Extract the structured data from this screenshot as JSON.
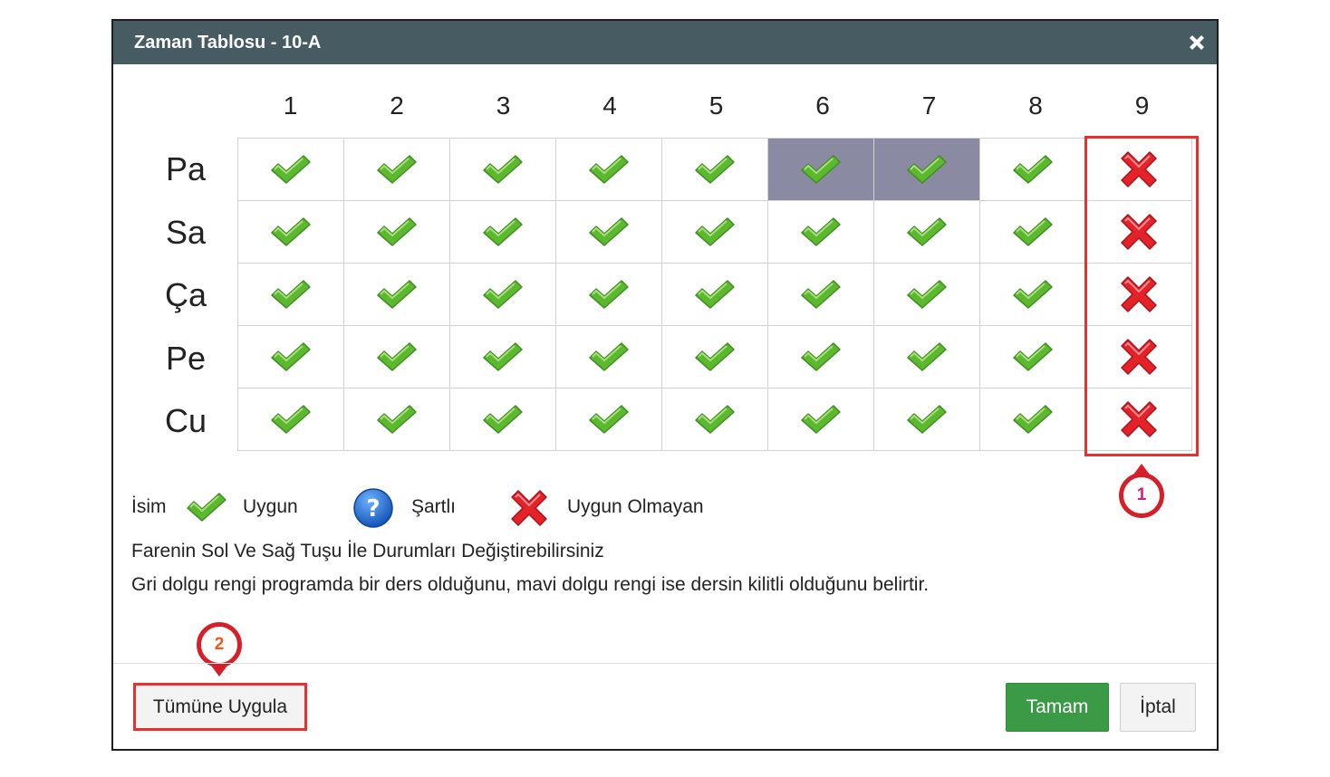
{
  "dialog": {
    "title": "Zaman Tablosu - 10-A"
  },
  "grid": {
    "columns": [
      "1",
      "2",
      "3",
      "4",
      "5",
      "6",
      "7",
      "8",
      "9"
    ],
    "rows": [
      {
        "label": "Pa",
        "cells": [
          "available",
          "available",
          "available",
          "available",
          "available",
          "available",
          "available",
          "available",
          "unavailable"
        ],
        "busy": [
          false,
          false,
          false,
          false,
          false,
          true,
          true,
          false,
          false
        ]
      },
      {
        "label": "Sa",
        "cells": [
          "available",
          "available",
          "available",
          "available",
          "available",
          "available",
          "available",
          "available",
          "unavailable"
        ],
        "busy": [
          false,
          false,
          false,
          false,
          false,
          false,
          false,
          false,
          false
        ]
      },
      {
        "label": "Ça",
        "cells": [
          "available",
          "available",
          "available",
          "available",
          "available",
          "available",
          "available",
          "available",
          "unavailable"
        ],
        "busy": [
          false,
          false,
          false,
          false,
          false,
          false,
          false,
          false,
          false
        ]
      },
      {
        "label": "Pe",
        "cells": [
          "available",
          "available",
          "available",
          "available",
          "available",
          "available",
          "available",
          "available",
          "unavailable"
        ],
        "busy": [
          false,
          false,
          false,
          false,
          false,
          false,
          false,
          false,
          false
        ]
      },
      {
        "label": "Cu",
        "cells": [
          "available",
          "available",
          "available",
          "available",
          "available",
          "available",
          "available",
          "available",
          "unavailable"
        ],
        "busy": [
          false,
          false,
          false,
          false,
          false,
          false,
          false,
          false,
          false
        ]
      }
    ],
    "busy_color": "#8a8aa3"
  },
  "legend": {
    "name_label": "İsim",
    "available_label": "Uygun",
    "conditional_label": "Şartlı",
    "unavailable_label": "Uygun Olmayan",
    "icons": [
      "check-icon",
      "question-icon",
      "cross-icon"
    ]
  },
  "info": {
    "line1": "Farenin Sol Ve Sağ Tuşu İle Durumları Değiştirebilirsiniz",
    "line2": "Gri dolgu rengi programda bir ders olduğunu, mavi dolgu rengi ise dersin kilitli olduğunu belirtir."
  },
  "annotations": {
    "callout1": "1",
    "callout2": "2",
    "highlight_color": "#e8302f"
  },
  "buttons": {
    "apply_all": "Tümüne Uygula",
    "ok": "Tamam",
    "cancel": "İptal"
  },
  "colors": {
    "titlebar": "#475b62",
    "ok_button": "#3a9a45",
    "check": "#5cb82e",
    "cross": "#e3222a",
    "question": "#1f6fd1"
  }
}
